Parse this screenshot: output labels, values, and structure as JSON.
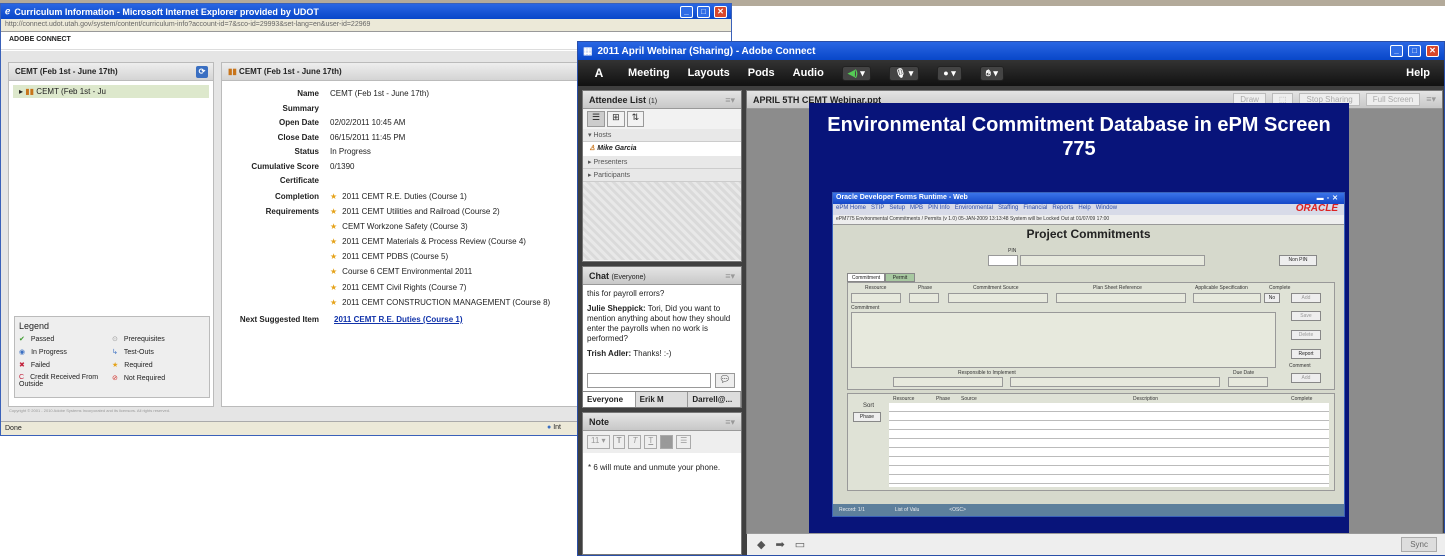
{
  "ie": {
    "title": "Curriculum Information - Microsoft Internet Explorer provided by UDOT",
    "address": "http://connect.udot.utah.gov/system/content/curriculum-info?account-id=7&sco-id=29993&set-lang=en&user-id=22969",
    "brand": "ADOBE CONNECT",
    "status": "Done",
    "zone": "Int"
  },
  "curriculum": {
    "left_header": "CEMT (Feb 1st - June 17th)",
    "tree_item": "CEMT (Feb 1st - Ju",
    "right_header": "CEMT (Feb 1st - June 17th)",
    "legend_title": "Legend",
    "legend": [
      {
        "label": "Passed",
        "icon": "✔",
        "color": "#3a9a2a"
      },
      {
        "label": "Prerequisites",
        "icon": "⊙",
        "color": "#999999"
      },
      {
        "label": "In Progress",
        "icon": "◉",
        "color": "#3a6fc2"
      },
      {
        "label": "Test-Outs",
        "icon": "↳",
        "color": "#3a6fc2"
      },
      {
        "label": "Failed",
        "icon": "✖",
        "color": "#c2203a"
      },
      {
        "label": "Required",
        "icon": "★",
        "color": "#e5a31a"
      },
      {
        "label": "Credit Received From Outside",
        "icon": "C",
        "color": "#c2203a"
      },
      {
        "label": "Not Required",
        "icon": "⊘",
        "color": "#d0302a"
      }
    ],
    "fields": [
      {
        "k": "Name",
        "v": "CEMT (Feb 1st - June 17th)"
      },
      {
        "k": "Summary",
        "v": ""
      },
      {
        "k": "Open Date",
        "v": "02/02/2011 10:45 AM"
      },
      {
        "k": "Close Date",
        "v": "06/15/2011 11:45 PM"
      },
      {
        "k": "Status",
        "v": "In Progress"
      },
      {
        "k": "Cumulative Score",
        "v": "0/1390"
      },
      {
        "k": "Certificate",
        "v": ""
      }
    ],
    "completion_label": "Completion Requirements",
    "requirements": [
      "2011 CEMT R.E. Duties (Course 1)",
      "2011 CEMT Utilities and Railroad (Course 2)",
      "CEMT Workzone Safety (Course 3)",
      "2011 CEMT Materials & Process Review (Course 4)",
      "2011 CEMT PDBS (Course 5)",
      "Course 6 CEMT Environmental 2011",
      "2011 CEMT Civil Rights (Course 7)",
      "2011 CEMT CONSTRUCTION MANAGEMENT (Course 8)"
    ],
    "next_label": "Next Suggested Item",
    "next_value": "2011 CEMT R.E. Duties (Course 1)",
    "footer": "Copyright © 2001 - 2010 Adobe Systems Incorporated and its licensors. All rights reserved."
  },
  "connect": {
    "title": "2011 April Webinar (Sharing) - Adobe Connect",
    "logo": "Adobe",
    "menu": [
      "Meeting",
      "Layouts",
      "Pods",
      "Audio"
    ],
    "help": "Help",
    "attendee": {
      "title": "Attendee List",
      "count": "(1)",
      "hosts": "Hosts",
      "host_name": "Mike Garcia",
      "presenters": "Presenters",
      "participants": "Participants"
    },
    "chat": {
      "title": "Chat",
      "scope": "(Everyone)",
      "messages": [
        {
          "who": "",
          "text": "this for payroll errors?"
        },
        {
          "who": "Julie Sheppick:",
          "text": "Tori, Did you want to mention anything about how they should enter the payrolls when no work is performed?"
        },
        {
          "who": "Trish Adler:",
          "text": "Thanks! :-)"
        }
      ],
      "tabs": [
        "Everyone",
        "Erik M",
        "Darrell@..."
      ]
    },
    "note": {
      "title": "Note",
      "font_size": "11",
      "text": "* 6 will  mute and unmute your phone."
    },
    "share": {
      "title": "APRIL 5TH CEMT Webinar.ppt",
      "draw": "Draw",
      "stop": "Stop Sharing",
      "full": "Full Screen",
      "sync": "Sync"
    },
    "slide": {
      "title": "Environmental Commitment Database in ePM Screen 775",
      "forms_title": "Oracle Developer Forms Runtime - Web",
      "forms_menu": [
        "ePM Home",
        "STIP",
        "Setup",
        "MPB",
        "PIN Info",
        "Environmental",
        "Staffing",
        "Financial",
        "Reports",
        "Help",
        "Window"
      ],
      "oracle": "ORACLE",
      "sub": "ePM775 Environmental Commitments / Permits (v 1.0)  05-JAN-2009 13:13:48 System will be Locked Out at 01/07/09 17:00",
      "heading": "Project Commitments",
      "pin": "PIN",
      "nonpin": "Non PIN",
      "tab1": "Commitment",
      "tab2": "Permit",
      "cols": [
        "Resource",
        "Phase",
        "Commitment Source",
        "Plan Sheet Reference",
        "Applicable Specification",
        "Complete"
      ],
      "no": "No",
      "add": "Add",
      "commitment": "Commitment",
      "save": "Save",
      "delete": "Delete",
      "report": "Report",
      "comment": "Comment",
      "responsible": "Responsible to Implement",
      "due": "Due Date",
      "sort": "Sort",
      "phase_btn": "Phase",
      "grid_cols": [
        "Resource",
        "Phase",
        "Source",
        "Description",
        "Complete"
      ],
      "status": [
        "Record: 1/1",
        "List of Valu",
        "<OSC>"
      ]
    }
  }
}
